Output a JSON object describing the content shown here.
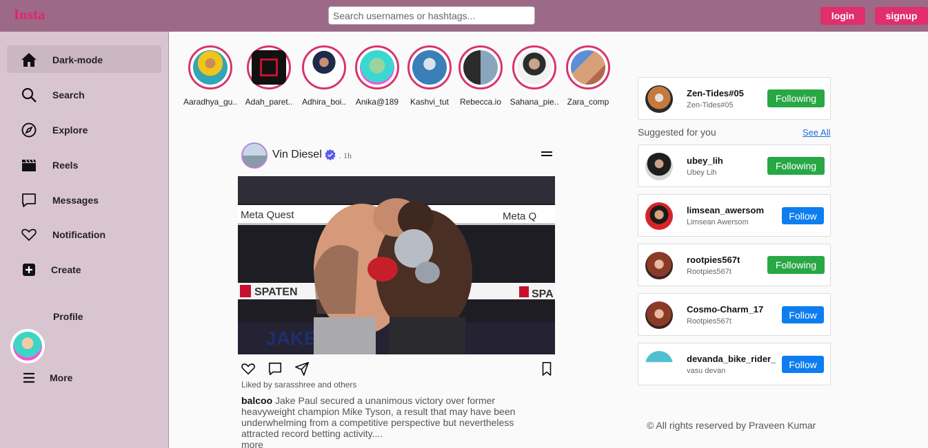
{
  "header": {
    "brand": "Insta",
    "search_placeholder": "Search usernames or hashtags...",
    "login_label": "login",
    "signup_label": "signup",
    "color": "#9c6a86"
  },
  "sidebar": {
    "items": [
      {
        "label": "Dark-mode",
        "icon": "home-icon",
        "active": true
      },
      {
        "label": "Search",
        "icon": "search-icon"
      },
      {
        "label": "Explore",
        "icon": "compass-icon"
      },
      {
        "label": "Reels",
        "icon": "clapperboard-icon"
      },
      {
        "label": "Messages",
        "icon": "message-icon"
      },
      {
        "label": "Notification",
        "icon": "heart-icon"
      },
      {
        "label": "Create",
        "icon": "plus-square-icon"
      },
      {
        "label": "Profile",
        "icon": "avatar"
      },
      {
        "label": "More",
        "icon": "menu-icon"
      }
    ]
  },
  "stories": [
    {
      "name": "Aaradhya_gu.."
    },
    {
      "name": "Adah_paret.."
    },
    {
      "name": "Adhira_boi.."
    },
    {
      "name": "Anika@189"
    },
    {
      "name": "Kashvi_tut"
    },
    {
      "name": "Rebecca.io"
    },
    {
      "name": "Sahana_pie.."
    },
    {
      "name": "Zara_comp"
    }
  ],
  "post": {
    "user": "Vin Diesel",
    "time": ". 1h",
    "image_signs": {
      "ad1": "Meta Quest",
      "ad2": "Meta Q",
      "ad3": "SPATEN",
      "ad4": "SPA",
      "floor": "JAKE  vs  M"
    },
    "likes_text": "Liked by sarasshree and others",
    "caption_user": "balcoo",
    "caption_text": "Jake Paul secured a unanimous victory over former heavyweight champion Mike Tyson, a result that may have been underwhelming from a competitive perspective but nevertheless attracted record betting activity....",
    "more_label": "more"
  },
  "right": {
    "current_user": {
      "username": "Zen-Tides#05",
      "sub": "Zen-Tides#05",
      "button": "Following"
    },
    "suggested_title": "Suggested for you",
    "see_all": "See All",
    "suggestions": [
      {
        "username": "ubey_lih",
        "sub": "Ubey Lih",
        "button": "Following"
      },
      {
        "username": "limsean_awersom",
        "sub": "Limsean Awersom",
        "button": "Follow"
      },
      {
        "username": "rootpies567t",
        "sub": "Rootpies567t",
        "button": "Following"
      },
      {
        "username": "Cosmo-Charm_17",
        "sub": "Rootpies567t",
        "button": "Follow"
      },
      {
        "username": "devanda_bike_rider_",
        "sub": "vasu devan",
        "button": "Follow"
      }
    ],
    "footer": "© All rights reserved by Praveen Kumar"
  }
}
